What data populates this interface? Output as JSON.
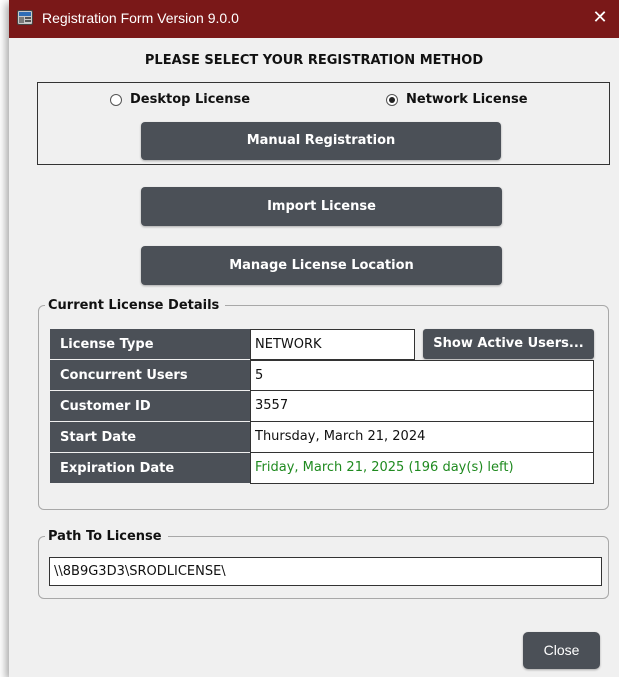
{
  "window": {
    "title": "Registration Form Version 9.0.0",
    "close_glyph": "✕",
    "titlebar_color": "#7a1818"
  },
  "heading": "PLEASE SELECT YOUR REGISTRATION METHOD",
  "registration_method": {
    "options": [
      {
        "label": "Desktop License",
        "selected": false
      },
      {
        "label": "Network License",
        "selected": true
      }
    ]
  },
  "buttons": {
    "manual_registration": "Manual Registration",
    "import_license": "Import License",
    "manage_license_location": "Manage License Location",
    "show_active_users": "Show Active Users...",
    "close": "Close"
  },
  "details": {
    "group_title": "Current License Details",
    "rows": [
      {
        "label": "License Type",
        "value": "NETWORK"
      },
      {
        "label": "Concurrent Users",
        "value": "5"
      },
      {
        "label": "Customer ID",
        "value": "3557"
      },
      {
        "label": "Start Date",
        "value": "Thursday, March 21, 2024"
      },
      {
        "label": "Expiration Date",
        "value": "Friday, March 21, 2025 (196 day(s) left)"
      }
    ]
  },
  "path": {
    "group_title": "Path To License",
    "value": "\\\\8B9G3D3\\SRODLICENSE\\"
  },
  "colors": {
    "button_bg": "#4b5057",
    "expiration_text": "#1f8a1f"
  }
}
